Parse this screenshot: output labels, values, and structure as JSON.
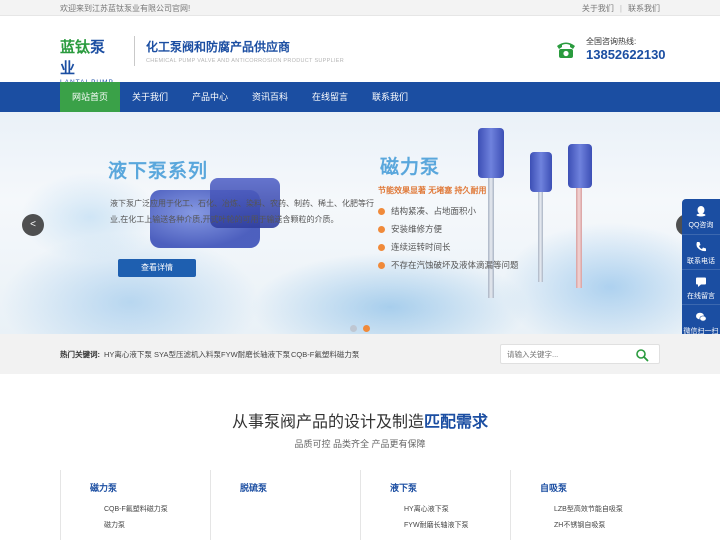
{
  "topbar": {
    "welcome": "欢迎来到江苏蓝钛泵业有限公司官网!",
    "about": "关于我们",
    "contact": "联系我们"
  },
  "header": {
    "logo_cn_green": "蓝钛",
    "logo_cn_blue": "泵业",
    "logo_en": "LANTAI PUMP",
    "slogan_cn": "化工泵阀和防腐产品供应商",
    "slogan_en": "CHEMICAL PUMP VALVE AND ANTICORROSION PRODUCT SUPPLIER",
    "hotline_label": "全国咨询热线:",
    "hotline_number": "13852622130"
  },
  "nav": {
    "items": [
      {
        "label": "网站首页",
        "active": true
      },
      {
        "label": "关于我们",
        "active": false
      },
      {
        "label": "产品中心",
        "active": false
      },
      {
        "label": "资讯百科",
        "active": false
      },
      {
        "label": "在线留言",
        "active": false
      },
      {
        "label": "联系我们",
        "active": false
      }
    ]
  },
  "banner": {
    "left_title": "液下泵系列",
    "left_desc": "液下泵广泛应用于化工、石化、冶炼、染料、农药、制药、稀土、化肥等行业,在化工上输送各种介质,开式叶轮的可用于输送含颗粒的介质。",
    "detail_button": "查看详情",
    "right_title": "磁力泵",
    "right_subtitle": "节能效果显著 无堵塞 持久耐用",
    "features": [
      "结构紧凑、占地面积小",
      "安装维修方便",
      "连续运转时间长",
      "不存在汽蚀破坏及液体滴漏等问题"
    ],
    "prev_arrow": "<",
    "next_arrow": ">",
    "active_slide": 2,
    "slide_count": 2
  },
  "service": {
    "items": [
      {
        "label": "QQ咨询",
        "icon": "qq-icon"
      },
      {
        "label": "联系电话",
        "icon": "phone-icon"
      },
      {
        "label": "在线留言",
        "icon": "message-icon"
      },
      {
        "label": "微信扫一扫",
        "icon": "wechat-icon"
      }
    ]
  },
  "keywords": {
    "label": "热门关键词:",
    "items": [
      "HY离心液下泵",
      "SYA型压滤机入料泵",
      "FYW耐磨长轴液下泵",
      "CQB-F氟塑料磁力泵"
    ],
    "search_placeholder": "请输入关键字..."
  },
  "section": {
    "headline_prefix": "从事泵阀产品的设计及制造",
    "headline_highlight": "匹配需求",
    "subline": "品质可控 品类齐全 产品更有保障"
  },
  "products": {
    "columns": [
      {
        "title": "磁力泵",
        "items": [
          "CQB-F氟塑料磁力泵",
          "磁力泵"
        ]
      },
      {
        "title": "脱硫泵",
        "items": []
      },
      {
        "title": "液下泵",
        "items": [
          "HY离心液下泵",
          "FYW耐磨长轴液下泵"
        ]
      },
      {
        "title": "自吸泵",
        "items": [
          "LZB型高效节能自吸泵",
          "ZH不锈钢自吸泵"
        ]
      }
    ]
  },
  "colors": {
    "brand_blue": "#1b4ea2",
    "brand_green": "#3aa148",
    "accent_orange": "#f08a3a"
  }
}
